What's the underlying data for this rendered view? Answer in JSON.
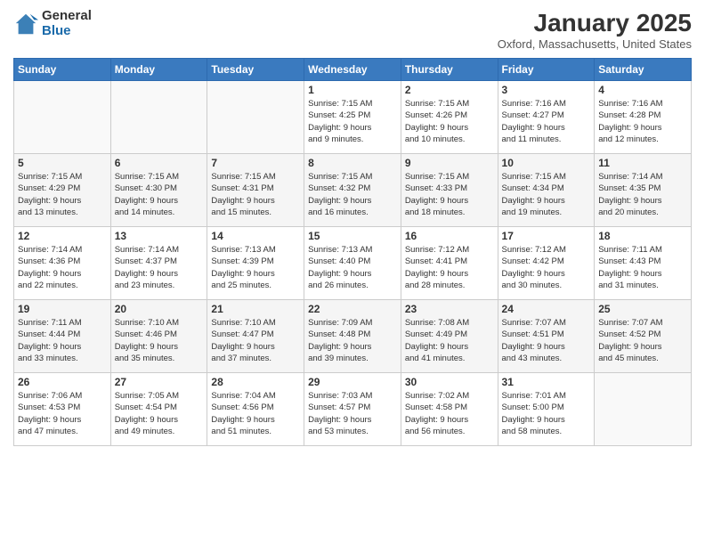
{
  "logo": {
    "general": "General",
    "blue": "Blue"
  },
  "header": {
    "month": "January 2025",
    "location": "Oxford, Massachusetts, United States"
  },
  "weekdays": [
    "Sunday",
    "Monday",
    "Tuesday",
    "Wednesday",
    "Thursday",
    "Friday",
    "Saturday"
  ],
  "weeks": [
    [
      {
        "day": "",
        "info": ""
      },
      {
        "day": "",
        "info": ""
      },
      {
        "day": "",
        "info": ""
      },
      {
        "day": "1",
        "info": "Sunrise: 7:15 AM\nSunset: 4:25 PM\nDaylight: 9 hours\nand 9 minutes."
      },
      {
        "day": "2",
        "info": "Sunrise: 7:15 AM\nSunset: 4:26 PM\nDaylight: 9 hours\nand 10 minutes."
      },
      {
        "day": "3",
        "info": "Sunrise: 7:16 AM\nSunset: 4:27 PM\nDaylight: 9 hours\nand 11 minutes."
      },
      {
        "day": "4",
        "info": "Sunrise: 7:16 AM\nSunset: 4:28 PM\nDaylight: 9 hours\nand 12 minutes."
      }
    ],
    [
      {
        "day": "5",
        "info": "Sunrise: 7:15 AM\nSunset: 4:29 PM\nDaylight: 9 hours\nand 13 minutes."
      },
      {
        "day": "6",
        "info": "Sunrise: 7:15 AM\nSunset: 4:30 PM\nDaylight: 9 hours\nand 14 minutes."
      },
      {
        "day": "7",
        "info": "Sunrise: 7:15 AM\nSunset: 4:31 PM\nDaylight: 9 hours\nand 15 minutes."
      },
      {
        "day": "8",
        "info": "Sunrise: 7:15 AM\nSunset: 4:32 PM\nDaylight: 9 hours\nand 16 minutes."
      },
      {
        "day": "9",
        "info": "Sunrise: 7:15 AM\nSunset: 4:33 PM\nDaylight: 9 hours\nand 18 minutes."
      },
      {
        "day": "10",
        "info": "Sunrise: 7:15 AM\nSunset: 4:34 PM\nDaylight: 9 hours\nand 19 minutes."
      },
      {
        "day": "11",
        "info": "Sunrise: 7:14 AM\nSunset: 4:35 PM\nDaylight: 9 hours\nand 20 minutes."
      }
    ],
    [
      {
        "day": "12",
        "info": "Sunrise: 7:14 AM\nSunset: 4:36 PM\nDaylight: 9 hours\nand 22 minutes."
      },
      {
        "day": "13",
        "info": "Sunrise: 7:14 AM\nSunset: 4:37 PM\nDaylight: 9 hours\nand 23 minutes."
      },
      {
        "day": "14",
        "info": "Sunrise: 7:13 AM\nSunset: 4:39 PM\nDaylight: 9 hours\nand 25 minutes."
      },
      {
        "day": "15",
        "info": "Sunrise: 7:13 AM\nSunset: 4:40 PM\nDaylight: 9 hours\nand 26 minutes."
      },
      {
        "day": "16",
        "info": "Sunrise: 7:12 AM\nSunset: 4:41 PM\nDaylight: 9 hours\nand 28 minutes."
      },
      {
        "day": "17",
        "info": "Sunrise: 7:12 AM\nSunset: 4:42 PM\nDaylight: 9 hours\nand 30 minutes."
      },
      {
        "day": "18",
        "info": "Sunrise: 7:11 AM\nSunset: 4:43 PM\nDaylight: 9 hours\nand 31 minutes."
      }
    ],
    [
      {
        "day": "19",
        "info": "Sunrise: 7:11 AM\nSunset: 4:44 PM\nDaylight: 9 hours\nand 33 minutes."
      },
      {
        "day": "20",
        "info": "Sunrise: 7:10 AM\nSunset: 4:46 PM\nDaylight: 9 hours\nand 35 minutes."
      },
      {
        "day": "21",
        "info": "Sunrise: 7:10 AM\nSunset: 4:47 PM\nDaylight: 9 hours\nand 37 minutes."
      },
      {
        "day": "22",
        "info": "Sunrise: 7:09 AM\nSunset: 4:48 PM\nDaylight: 9 hours\nand 39 minutes."
      },
      {
        "day": "23",
        "info": "Sunrise: 7:08 AM\nSunset: 4:49 PM\nDaylight: 9 hours\nand 41 minutes."
      },
      {
        "day": "24",
        "info": "Sunrise: 7:07 AM\nSunset: 4:51 PM\nDaylight: 9 hours\nand 43 minutes."
      },
      {
        "day": "25",
        "info": "Sunrise: 7:07 AM\nSunset: 4:52 PM\nDaylight: 9 hours\nand 45 minutes."
      }
    ],
    [
      {
        "day": "26",
        "info": "Sunrise: 7:06 AM\nSunset: 4:53 PM\nDaylight: 9 hours\nand 47 minutes."
      },
      {
        "day": "27",
        "info": "Sunrise: 7:05 AM\nSunset: 4:54 PM\nDaylight: 9 hours\nand 49 minutes."
      },
      {
        "day": "28",
        "info": "Sunrise: 7:04 AM\nSunset: 4:56 PM\nDaylight: 9 hours\nand 51 minutes."
      },
      {
        "day": "29",
        "info": "Sunrise: 7:03 AM\nSunset: 4:57 PM\nDaylight: 9 hours\nand 53 minutes."
      },
      {
        "day": "30",
        "info": "Sunrise: 7:02 AM\nSunset: 4:58 PM\nDaylight: 9 hours\nand 56 minutes."
      },
      {
        "day": "31",
        "info": "Sunrise: 7:01 AM\nSunset: 5:00 PM\nDaylight: 9 hours\nand 58 minutes."
      },
      {
        "day": "",
        "info": ""
      }
    ]
  ]
}
